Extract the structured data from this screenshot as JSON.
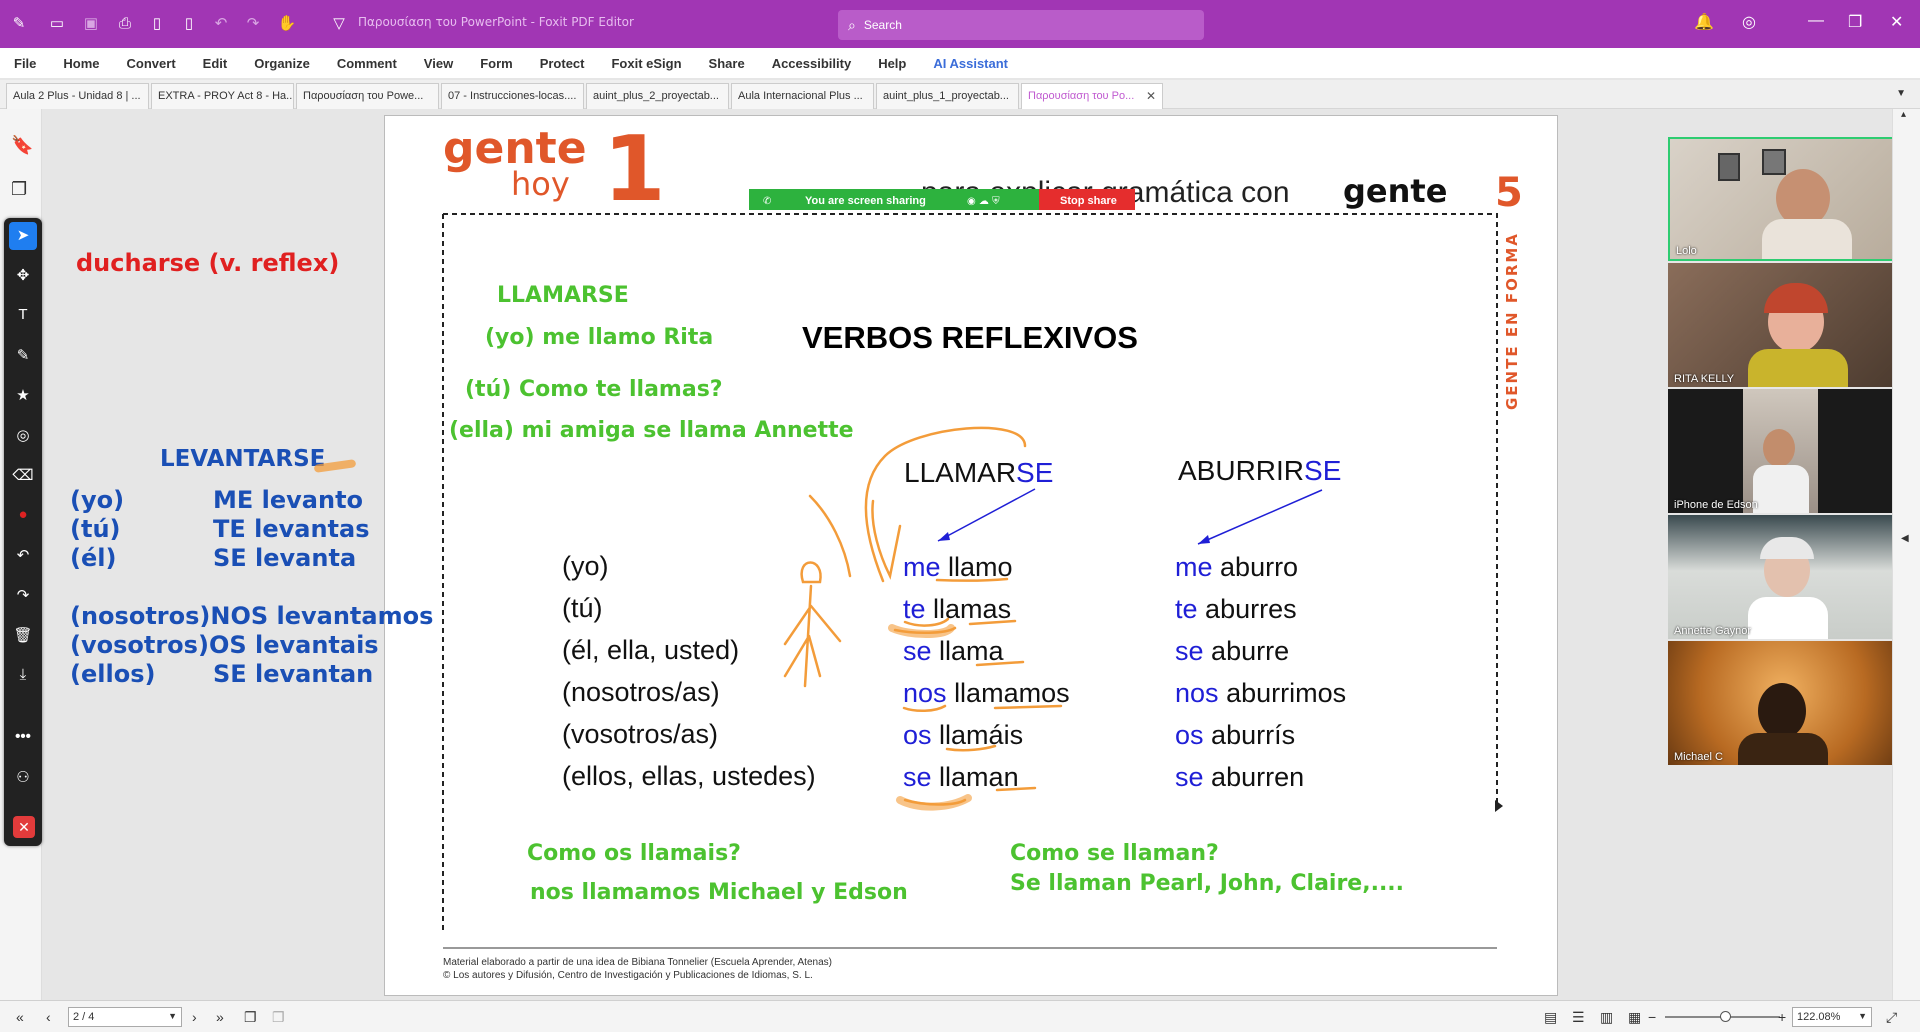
{
  "app": {
    "title": "Παρουσίαση του PowerPoint - Foxit PDF Editor",
    "search_placeholder": "Search"
  },
  "menu": [
    "File",
    "Home",
    "Convert",
    "Edit",
    "Organize",
    "Comment",
    "View",
    "Form",
    "Protect",
    "Foxit eSign",
    "Share",
    "Accessibility",
    "Help",
    "AI Assistant"
  ],
  "tabs": [
    "Aula 2 Plus - Unidad 8 | ...",
    "EXTRA - PROY Act 8 - Ha...",
    "Παρουσίαση του Powe...",
    "07 - Instrucciones-locas....",
    "auint_plus_2_proyectab...",
    "Aula Internacional Plus ...",
    "auint_plus_1_proyectab...",
    "Παρουσίαση του Po..."
  ],
  "notes_left": {
    "ducharse": "ducharse (v.  reflex)",
    "levantarse": "LEVANTARSE",
    "rows": [
      {
        "p": "(yo)",
        "v": "ME  levanto"
      },
      {
        "p": "(tú)",
        "v": "TE  levantas"
      },
      {
        "p": "(él)",
        "v": "SE  levanta"
      },
      {
        "p": "(nosotros)",
        "v": "NOS levantamos"
      },
      {
        "p": "(vosotros)",
        "v": "OS levantais"
      },
      {
        "p": "(ellos)",
        "v": "SE levantan"
      }
    ]
  },
  "slide": {
    "brand_gente": "gente",
    "brand_hoy": "hoy",
    "brand_num": "1",
    "subtitle_pre": "para explicar gramática con",
    "subtitle_brand": "gente",
    "subtitle_num": "5",
    "side_label": "GENTE EN FORMA",
    "title": "VERBOS REFLEXIVOS",
    "green_notes": {
      "llamarse": "LLAMARSE",
      "yo_rita": "(yo) me llamo Rita",
      "tu_como": "(tú) Como te llamas?",
      "ella": "(ella) mi amiga se llama Annette",
      "os_q": "Como os llamais?",
      "nos_a": "nos llamamos Michael y Edson",
      "se_q": "Como se llaman?",
      "se_a": "Se llaman Pearl, John, Claire,...."
    },
    "col1_head_a": "LLAMAR",
    "col1_head_b": "SE",
    "col2_head_a": "ABURRIR",
    "col2_head_b": "SE",
    "pronouns": [
      "(yo)",
      "(tú)",
      "(él, ella, usted)",
      "(nosotros/as)",
      "(vosotros/as)",
      "(ellos, ellas, ustedes)"
    ],
    "col1": [
      [
        "me",
        "llamo"
      ],
      [
        "te",
        "llamas"
      ],
      [
        "se",
        "llama"
      ],
      [
        "nos",
        "llamamos"
      ],
      [
        "os",
        "llamáis"
      ],
      [
        "se",
        "llaman"
      ]
    ],
    "col2": [
      [
        "me",
        "aburro"
      ],
      [
        "te",
        "aburres"
      ],
      [
        "se",
        "aburre"
      ],
      [
        "nos",
        "aburrimos"
      ],
      [
        "os",
        "aburrís"
      ],
      [
        "se",
        "aburren"
      ]
    ],
    "footer1": "Material elaborado a partir de una idea de Bibiana Tonnelier (Escuela Aprender, Atenas)",
    "footer2": "© Los autores y Difusión, Centro de Investigación y Publicaciones de Idiomas, S. L."
  },
  "share_bar": {
    "text": "You are screen sharing",
    "stop": "Stop share"
  },
  "participants": [
    "Lolo",
    "RITA KELLY",
    "iPhone de Edson",
    "Annette Gaynor",
    "Michael C"
  ],
  "status": {
    "page": "2 / 4",
    "zoom": "122.08%"
  },
  "colors": {
    "brand": "#a136b4",
    "note_green": "#4cc230",
    "note_blue": "#1a4fb5",
    "note_red": "#e02020",
    "slide_blue": "#1f1fd6",
    "orange": "#f39c3a"
  }
}
